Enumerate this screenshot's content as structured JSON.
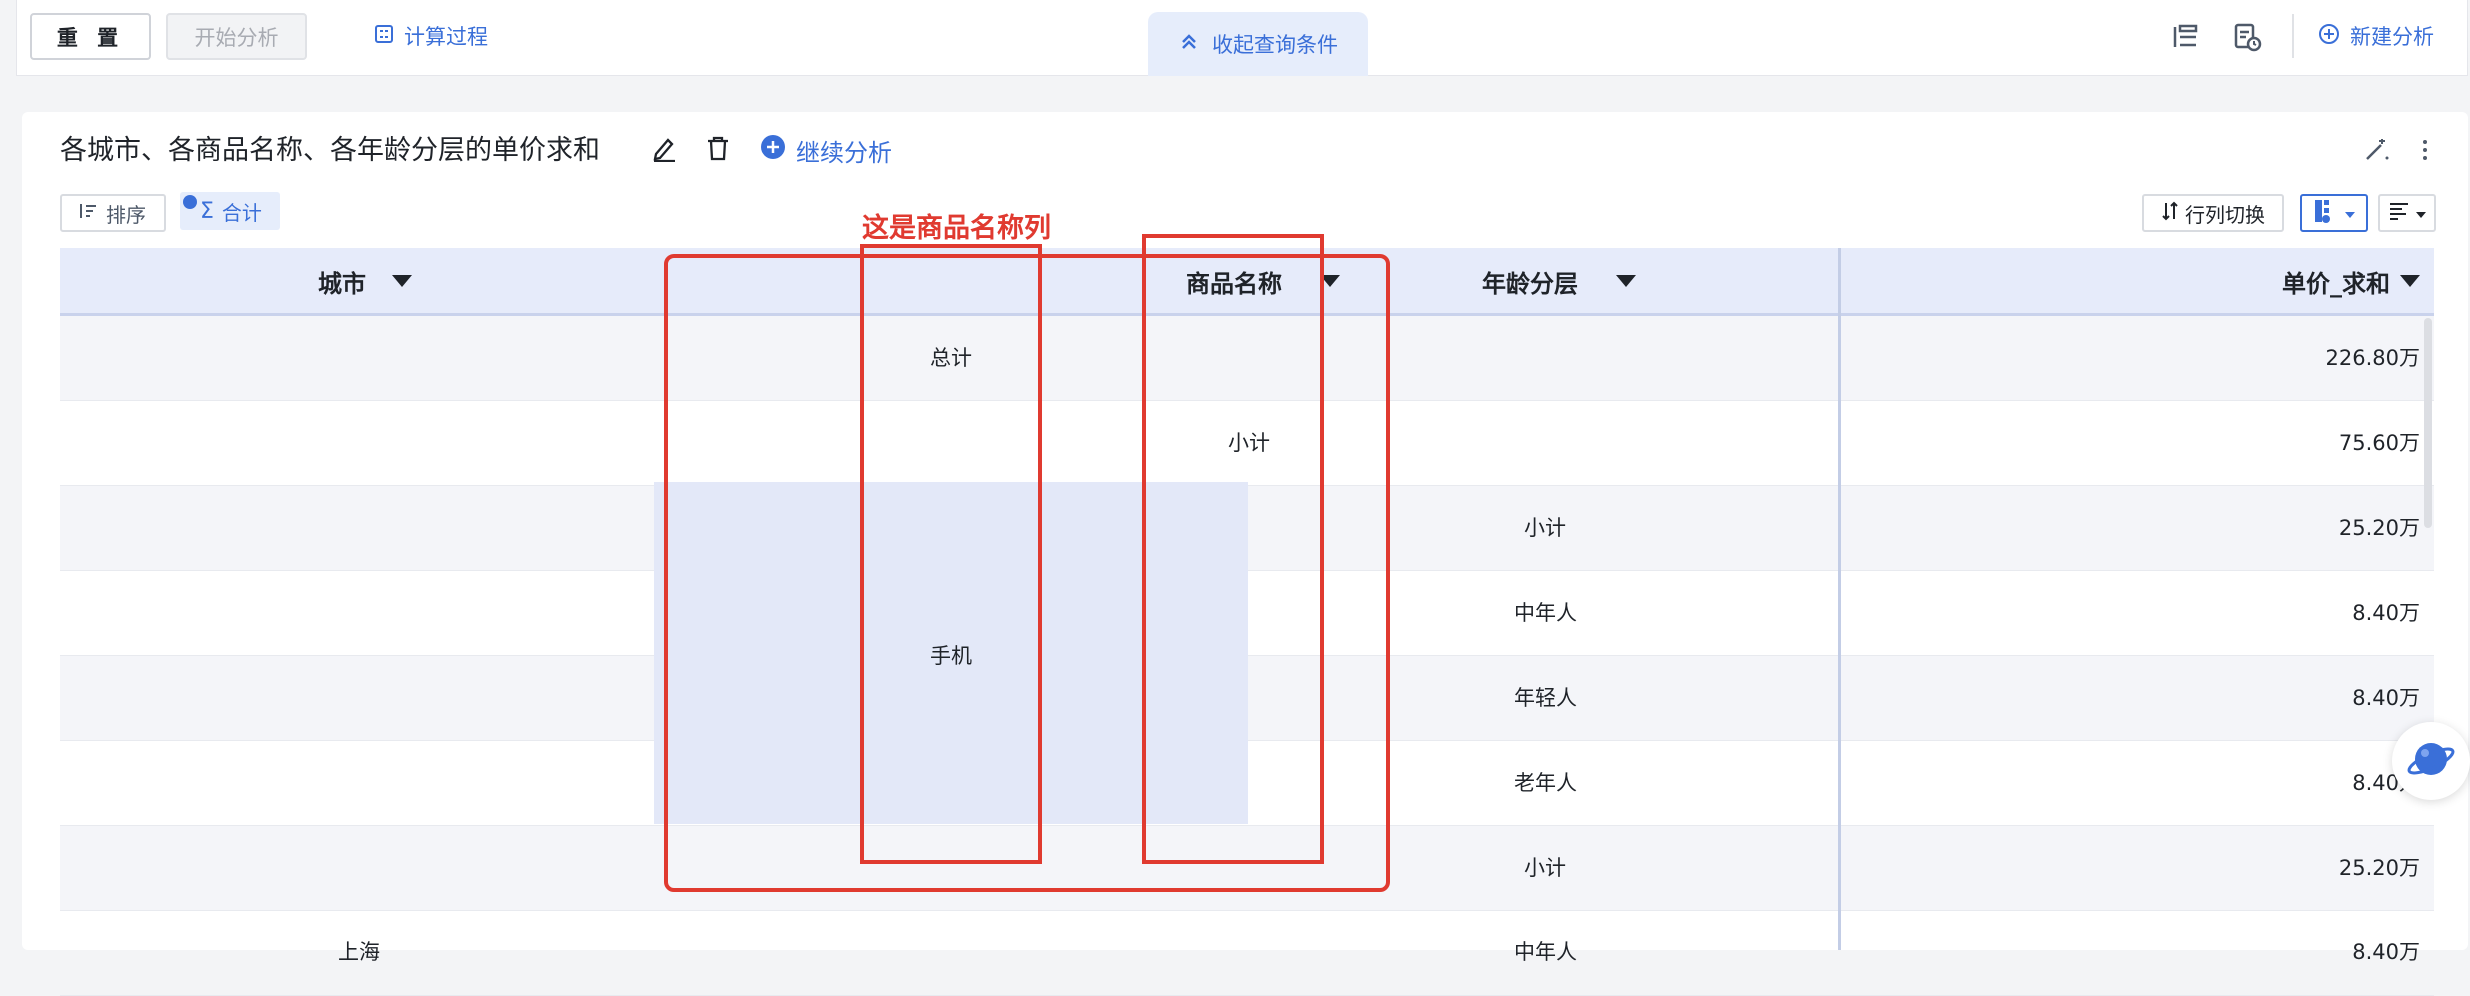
{
  "toolbar": {
    "reset_label": "重 置",
    "start_analysis_label": "开始分析",
    "calc_process_label": "计算过程",
    "collapse_label": "收起查询条件",
    "new_analysis_label": "新建分析"
  },
  "report": {
    "title": "各城市、各商品名称、各年龄分层的单价求和",
    "continue_label": "继续分析",
    "sort_label": "排序",
    "sum_label": "合计",
    "row_col_switch_label": "行列切换"
  },
  "table": {
    "columns": [
      "城市",
      "商品名称",
      "年龄分层",
      "单价_求和"
    ],
    "rows": [
      {
        "city": "",
        "product": "总计",
        "subtotal": "",
        "age": "",
        "value": "226.80万"
      },
      {
        "city": "",
        "product": "",
        "subtotal": "小计",
        "age": "",
        "value": "75.60万"
      },
      {
        "city": "",
        "product": "",
        "subtotal": "",
        "age": "小计",
        "value": "25.20万"
      },
      {
        "city": "",
        "product": "",
        "subtotal": "",
        "age": "中年人",
        "value": "8.40万"
      },
      {
        "city": "",
        "product": "手机",
        "subtotal": "",
        "age": "年轻人",
        "value": "8.40万"
      },
      {
        "city": "",
        "product": "",
        "subtotal": "",
        "age": "老年人",
        "value": "8.40万"
      },
      {
        "city": "",
        "product": "",
        "subtotal": "",
        "age": "小计",
        "value": "25.20万"
      },
      {
        "city": "上海",
        "product": "",
        "subtotal": "",
        "age": "中年人",
        "value": "8.40万"
      }
    ]
  },
  "annotation": {
    "text": "这是商品名称列",
    "color": "#e03a30"
  },
  "colors": {
    "accent": "#3a6fd8",
    "header_bg": "#e6ebfa",
    "highlight_bg": "#e3e8f8"
  },
  "icons": [
    "calculator-icon",
    "chevrons-up-icon",
    "tree-list-icon",
    "report-clock-icon",
    "plus-circle-icon",
    "edit-icon",
    "trash-icon",
    "magic-wand-icon",
    "more-vertical-icon",
    "sort-icon",
    "sigma-icon",
    "swap-icon",
    "table-view-icon",
    "list-view-icon",
    "planet-icon"
  ]
}
